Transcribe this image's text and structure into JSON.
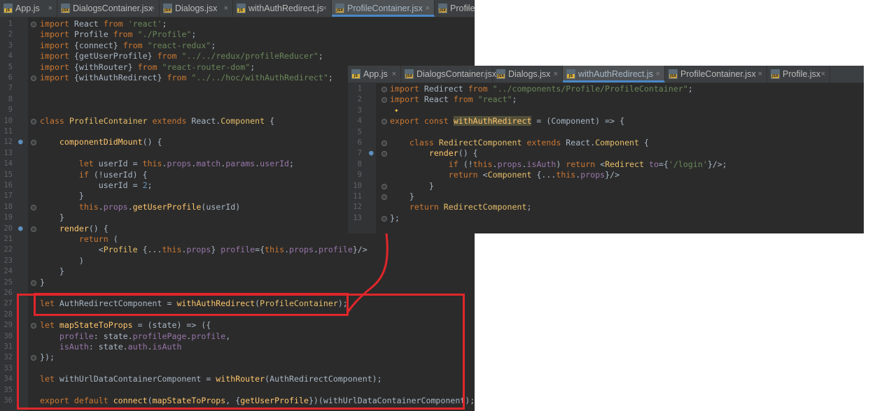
{
  "left_editor": {
    "tabs": [
      {
        "label": "App.js",
        "type": "JS",
        "active": false
      },
      {
        "label": "DialogsContainer.jsx",
        "type": "JSX",
        "active": false
      },
      {
        "label": "Dialogs.jsx",
        "type": "JSX",
        "active": false
      },
      {
        "label": "withAuthRedirect.js",
        "type": "JS",
        "active": false
      },
      {
        "label": "ProfileContainer.jsx",
        "type": "JSX",
        "active": true
      },
      {
        "label": "Profile",
        "type": "JSX",
        "active": false
      }
    ],
    "lines": [
      [
        [
          "kw",
          "import "
        ],
        [
          "",
          "React "
        ],
        [
          "kw",
          "from "
        ],
        [
          "str",
          "'react'"
        ],
        [
          "",
          ";"
        ]
      ],
      [
        [
          "kw",
          "import "
        ],
        [
          "",
          "Profile "
        ],
        [
          "kw",
          "from "
        ],
        [
          "str",
          "\"./Profile\""
        ],
        [
          "",
          ";"
        ]
      ],
      [
        [
          "kw",
          "import "
        ],
        [
          "",
          "{"
        ],
        [
          "",
          "connect"
        ],
        [
          "",
          "} "
        ],
        [
          "kw",
          "from "
        ],
        [
          "str",
          "\"react-redux\""
        ],
        [
          "",
          ";"
        ]
      ],
      [
        [
          "kw",
          "import "
        ],
        [
          "",
          "{"
        ],
        [
          "",
          "getUserProfile"
        ],
        [
          "",
          "} "
        ],
        [
          "kw",
          "from "
        ],
        [
          "str",
          "\"../../redux/profileReducer\""
        ],
        [
          "",
          ";"
        ]
      ],
      [
        [
          "kw",
          "import "
        ],
        [
          "",
          "{"
        ],
        [
          "",
          "withRouter"
        ],
        [
          "",
          "} "
        ],
        [
          "kw",
          "from "
        ],
        [
          "str",
          "\"react-router-dom\""
        ],
        [
          "",
          ";"
        ]
      ],
      [
        [
          "kw",
          "import "
        ],
        [
          "",
          "{"
        ],
        [
          "",
          "withAuthRedirect"
        ],
        [
          "",
          "} "
        ],
        [
          "kw",
          "from "
        ],
        [
          "str",
          "\"../../hoc/withAuthRedirect\""
        ],
        [
          "",
          ";"
        ]
      ],
      [],
      [],
      [],
      [
        [
          "kw",
          "class "
        ],
        [
          "cls",
          "ProfileContainer "
        ],
        [
          "kw",
          "extends "
        ],
        [
          "",
          "React."
        ],
        [
          "cls",
          "Component "
        ],
        [
          "",
          "{"
        ]
      ],
      [],
      [
        [
          "",
          "    "
        ],
        [
          "fn",
          "componentDidMount"
        ],
        [
          "",
          "() {"
        ]
      ],
      [],
      [
        [
          "",
          "        "
        ],
        [
          "kw",
          "let "
        ],
        [
          "",
          "userId = "
        ],
        [
          "kw",
          "this"
        ],
        [
          "",
          "."
        ],
        [
          "prop",
          "props"
        ],
        [
          "",
          "."
        ],
        [
          "prop",
          "match"
        ],
        [
          "",
          "."
        ],
        [
          "prop",
          "params"
        ],
        [
          "",
          "."
        ],
        [
          "prop",
          "userId"
        ],
        [
          "",
          ";"
        ]
      ],
      [
        [
          "",
          "        "
        ],
        [
          "kw",
          "if "
        ],
        [
          "",
          "(!userId) {"
        ]
      ],
      [
        [
          "",
          "            "
        ],
        [
          "",
          "userId = "
        ],
        [
          "num",
          "2"
        ],
        [
          "",
          ";"
        ]
      ],
      [
        [
          "",
          "        "
        ],
        [
          "",
          "}"
        ]
      ],
      [
        [
          "",
          "        "
        ],
        [
          "kw",
          "this"
        ],
        [
          "",
          "."
        ],
        [
          "prop",
          "props"
        ],
        [
          "",
          "."
        ],
        [
          "fn",
          "getUserProfile"
        ],
        [
          "",
          "(userId)"
        ]
      ],
      [
        [
          "",
          "    "
        ],
        [
          "",
          "}"
        ]
      ],
      [
        [
          "",
          "    "
        ],
        [
          "fn",
          "render"
        ],
        [
          "",
          "() {"
        ]
      ],
      [
        [
          "",
          "        "
        ],
        [
          "kw",
          "return "
        ],
        [
          "",
          "("
        ]
      ],
      [
        [
          "",
          "            "
        ],
        [
          "",
          "<"
        ],
        [
          "tag",
          "Profile "
        ],
        [
          "",
          "{..."
        ],
        [
          "kw",
          "this"
        ],
        [
          "",
          "."
        ],
        [
          "prop",
          "props"
        ],
        [
          "",
          "} "
        ],
        [
          "prop",
          "profile"
        ],
        [
          "",
          "={"
        ],
        [
          "kw",
          "this"
        ],
        [
          "",
          "."
        ],
        [
          "prop",
          "props"
        ],
        [
          "",
          "."
        ],
        [
          "prop",
          "profile"
        ],
        [
          "",
          "}/>"
        ]
      ],
      [
        [
          "",
          "        "
        ],
        [
          "",
          ")"
        ]
      ],
      [
        [
          "",
          "    "
        ],
        [
          "",
          "}"
        ]
      ],
      [
        [
          "",
          "}"
        ]
      ],
      [],
      [
        [
          "kw",
          "let "
        ],
        [
          "",
          "AuthRedirectComponent = "
        ],
        [
          "fn",
          "withAuthRedirect"
        ],
        [
          "",
          "("
        ],
        [
          "cls",
          "ProfileContainer"
        ],
        [
          "",
          ");"
        ]
      ],
      [],
      [
        [
          "kw",
          "let "
        ],
        [
          "fn",
          "mapStateToProps "
        ],
        [
          "",
          "= (state) => ({"
        ]
      ],
      [
        [
          "",
          "    "
        ],
        [
          "prop",
          "profile"
        ],
        [
          "",
          ": state."
        ],
        [
          "prop",
          "profilePage"
        ],
        [
          "",
          "."
        ],
        [
          "prop",
          "profile"
        ],
        [
          "",
          ","
        ]
      ],
      [
        [
          "",
          "    "
        ],
        [
          "prop",
          "isAuth"
        ],
        [
          "",
          ": state."
        ],
        [
          "prop",
          "auth"
        ],
        [
          "",
          "."
        ],
        [
          "prop",
          "isAuth"
        ]
      ],
      [
        [
          "",
          "});"
        ]
      ],
      [],
      [
        [
          "kw",
          "let "
        ],
        [
          "",
          "withUrlDataContainerComponent = "
        ],
        [
          "fn",
          "withRouter"
        ],
        [
          "",
          "(AuthRedirectComponent);"
        ]
      ],
      [],
      [
        [
          "kw",
          "export default "
        ],
        [
          "fn",
          "connect"
        ],
        [
          "",
          "("
        ],
        [
          "fn",
          "mapStateToProps"
        ],
        [
          "",
          ", {"
        ],
        [
          "fn",
          "getUserProfile"
        ],
        [
          "",
          "})(withUrlDataContainerComponent);"
        ]
      ]
    ]
  },
  "right_editor": {
    "tabs": [
      {
        "label": "App.js",
        "type": "JS",
        "active": false
      },
      {
        "label": "DialogsContainer.jsx",
        "type": "JSX",
        "active": false
      },
      {
        "label": "Dialogs.jsx",
        "type": "JSX",
        "active": false
      },
      {
        "label": "withAuthRedirect.js",
        "type": "JS",
        "active": true
      },
      {
        "label": "ProfileContainer.jsx",
        "type": "JSX",
        "active": false
      },
      {
        "label": "Profile.jsx",
        "type": "JSX",
        "active": false
      }
    ],
    "lines": [
      [
        [
          "kw",
          "import "
        ],
        [
          "",
          "Redirect "
        ],
        [
          "kw",
          "from "
        ],
        [
          "str",
          "\"../components/Profile/ProfileContainer\""
        ],
        [
          "",
          ";"
        ]
      ],
      [
        [
          "kw",
          "import "
        ],
        [
          "",
          "React "
        ],
        [
          "kw",
          "from "
        ],
        [
          "str",
          "\"react\""
        ],
        [
          "",
          ";"
        ]
      ],
      [],
      [
        [
          "kw",
          "export const "
        ],
        [
          "hl",
          "withAuthRedirect"
        ],
        [
          "",
          " = (Component) => {"
        ]
      ],
      [],
      [
        [
          "",
          "    "
        ],
        [
          "kw",
          "class "
        ],
        [
          "cls",
          "RedirectComponent "
        ],
        [
          "kw",
          "extends "
        ],
        [
          "",
          "React."
        ],
        [
          "cls",
          "Component "
        ],
        [
          "",
          "{"
        ]
      ],
      [
        [
          "",
          "        "
        ],
        [
          "fn",
          "render"
        ],
        [
          "",
          "() {"
        ]
      ],
      [
        [
          "",
          "            "
        ],
        [
          "kw",
          "if "
        ],
        [
          "",
          "(!"
        ],
        [
          "kw",
          "this"
        ],
        [
          "",
          "."
        ],
        [
          "prop",
          "props"
        ],
        [
          "",
          "."
        ],
        [
          "prop",
          "isAuth"
        ],
        [
          "",
          ") "
        ],
        [
          "kw",
          "return "
        ],
        [
          "",
          "<"
        ],
        [
          "tag",
          "Redirect "
        ],
        [
          "prop",
          "to"
        ],
        [
          "",
          "={"
        ],
        [
          "str",
          "'/login'"
        ],
        [
          "",
          "}/>;"
        ]
      ],
      [
        [
          "",
          "            "
        ],
        [
          "kw",
          "return "
        ],
        [
          "",
          "<"
        ],
        [
          "tag",
          "Component "
        ],
        [
          "",
          "{..."
        ],
        [
          "kw",
          "this"
        ],
        [
          "",
          "."
        ],
        [
          "prop",
          "props"
        ],
        [
          "",
          "}/>"
        ]
      ],
      [
        [
          "",
          "        "
        ],
        [
          "",
          "}"
        ]
      ],
      [
        [
          "",
          "    "
        ],
        [
          "",
          "}"
        ]
      ],
      [
        [
          "",
          "    "
        ],
        [
          "kw",
          "return "
        ],
        [
          "cls",
          "RedirectComponent"
        ],
        [
          "",
          ";"
        ]
      ],
      [
        [
          "",
          "};"
        ]
      ]
    ]
  },
  "colors": {
    "background": "#2b2b2b",
    "annotation": "#e0262b",
    "accent": "#4a88c7"
  }
}
